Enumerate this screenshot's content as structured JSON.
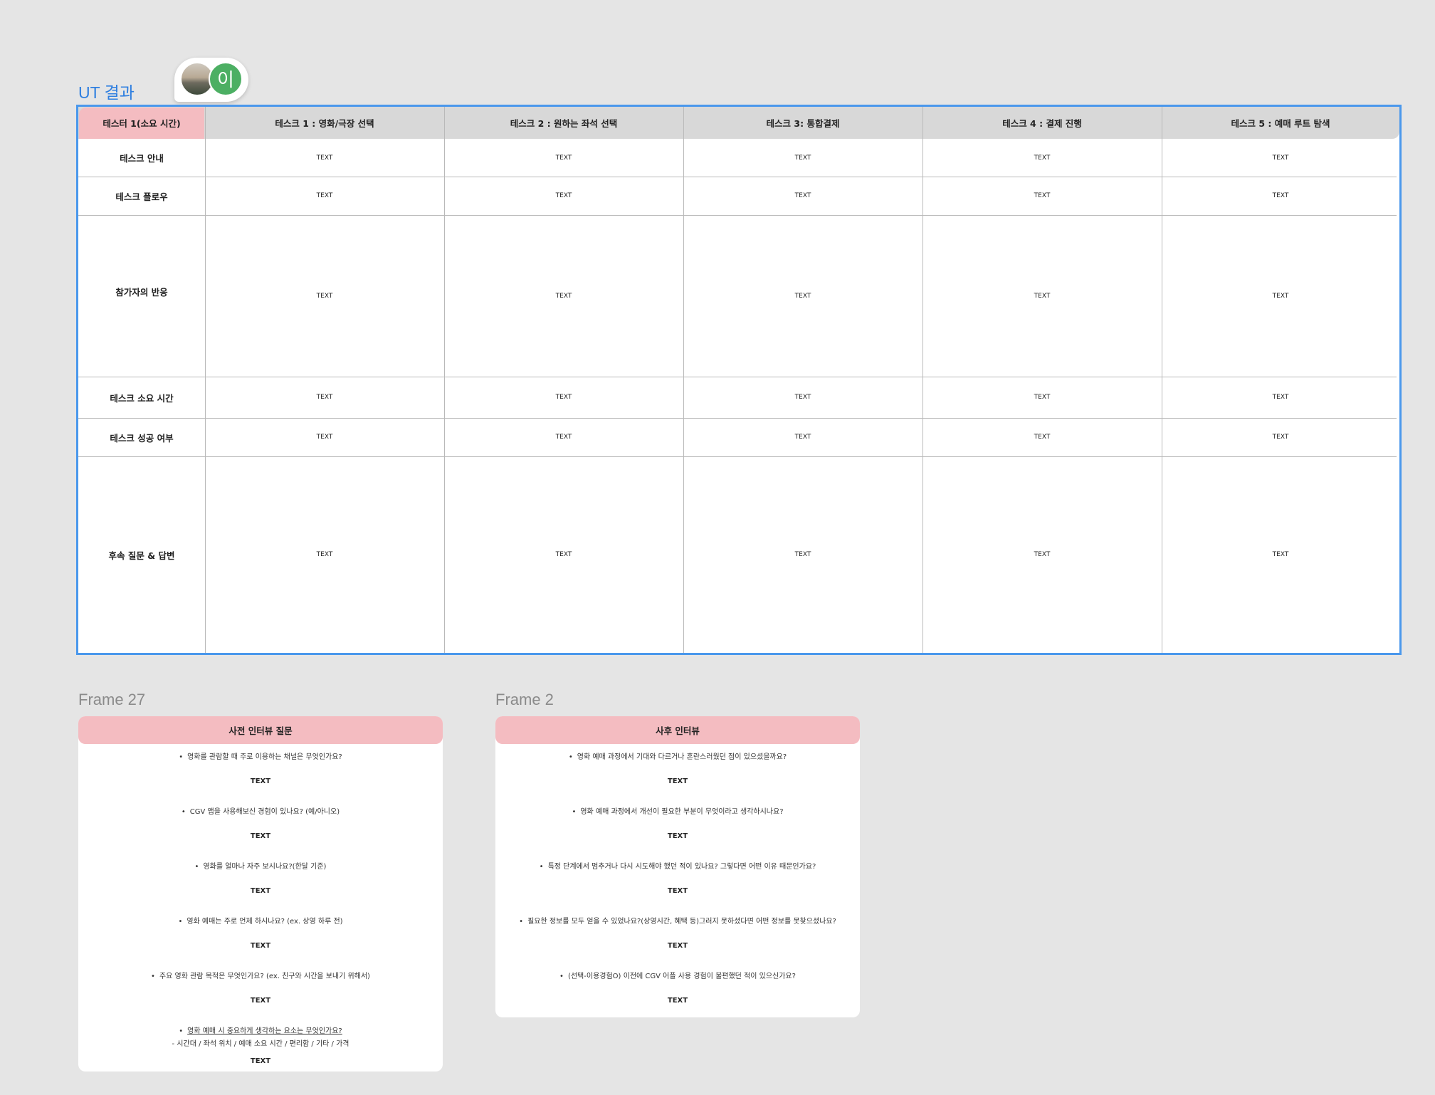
{
  "ut": {
    "title": "UT 결과",
    "avatar_letter": "이",
    "header": [
      "테스터 1(소요 시간)",
      "테스크 1 : 영화/극장 선택",
      "테스크 2 : 원하는 좌석 선택",
      "테스크 3: 통합결제",
      "테스크 4 : 결제 진행",
      "테스크 5 : 예매 루트 탐색"
    ],
    "rows": [
      {
        "label": "테스크 안내",
        "cells": [
          "TEXT",
          "TEXT",
          "TEXT",
          "TEXT",
          "TEXT"
        ]
      },
      {
        "label": "테스크 플로우",
        "cells": [
          "TEXT",
          "TEXT",
          "TEXT",
          "TEXT",
          "TEXT"
        ]
      },
      {
        "label": "참가자의 반응",
        "cells": [
          "TEXT",
          "TEXT",
          "TEXT",
          "TEXT",
          "TEXT"
        ]
      },
      {
        "label": "테스크 소요 시간",
        "cells": [
          "TEXT",
          "TEXT",
          "TEXT",
          "TEXT",
          "TEXT"
        ]
      },
      {
        "label": "테스크 성공 여부",
        "cells": [
          "TEXT",
          "TEXT",
          "TEXT",
          "TEXT",
          "TEXT"
        ]
      },
      {
        "label": "후속 질문 & 답변",
        "cells": [
          "TEXT",
          "TEXT",
          "TEXT",
          "TEXT",
          "TEXT"
        ]
      }
    ],
    "colors": {
      "selection": "#4a98ec",
      "header_bg": "#d8d8d8",
      "header_first_bg": "#f4bcc1"
    }
  },
  "frame27": {
    "label": "Frame 27",
    "title": "사전 인터뷰 질문",
    "items": [
      {
        "q": "영화를 관람할 때 주로 이용하는 채널은 무엇인가요?",
        "a": "TEXT"
      },
      {
        "q": "CGV 앱을 사용해보신 경험이 있나요? (예/아니오)",
        "a": "TEXT"
      },
      {
        "q": "영화를 얼마나 자주 보시나요?(한달 기준)",
        "a": "TEXT"
      },
      {
        "q": "영화 예매는 주로 언제 하시나요? (ex. 상영 하루 전)",
        "a": "TEXT"
      },
      {
        "q": "주요 영화 관람 목적은 무엇인가요? (ex. 친구와 시간을 보내기 위해서)",
        "a": "TEXT"
      },
      {
        "q": "영화 예매 시 중요하게 생각하는 요소는 무엇인가요?",
        "sub": "- 시간대 / 좌석 위치 / 예매 소요 시간 / 편리함 / 기타 / 가격",
        "a": "TEXT"
      }
    ]
  },
  "frame2": {
    "label": "Frame 2",
    "title": "사후 인터뷰",
    "items": [
      {
        "q": "영화 예매 과정에서 기대와 다르거나 혼란스러웠던 점이 있으셨을까요?",
        "a": "TEXT"
      },
      {
        "q": "영화 예매 과정에서 개선이 필요한 부분이 무엇이라고 생각하시나요?",
        "a": "TEXT"
      },
      {
        "q": "특정 단계에서 멈추거나 다시 시도해야 했던 적이 있나요? 그렇다면 어떤 이유 때문인가요?",
        "a": "TEXT"
      },
      {
        "q": "필요한 정보를 모두 얻을 수 있었나요?(상영시간, 혜택 등)그러지 못하셨다면 어떤 정보를 못찾으셨나요?",
        "a": "TEXT"
      },
      {
        "q": "(선택-이용경험O) 이전에 CGV 어플 사용 경험이 불편했던 적이 있으신가요?",
        "a": "TEXT"
      }
    ]
  }
}
